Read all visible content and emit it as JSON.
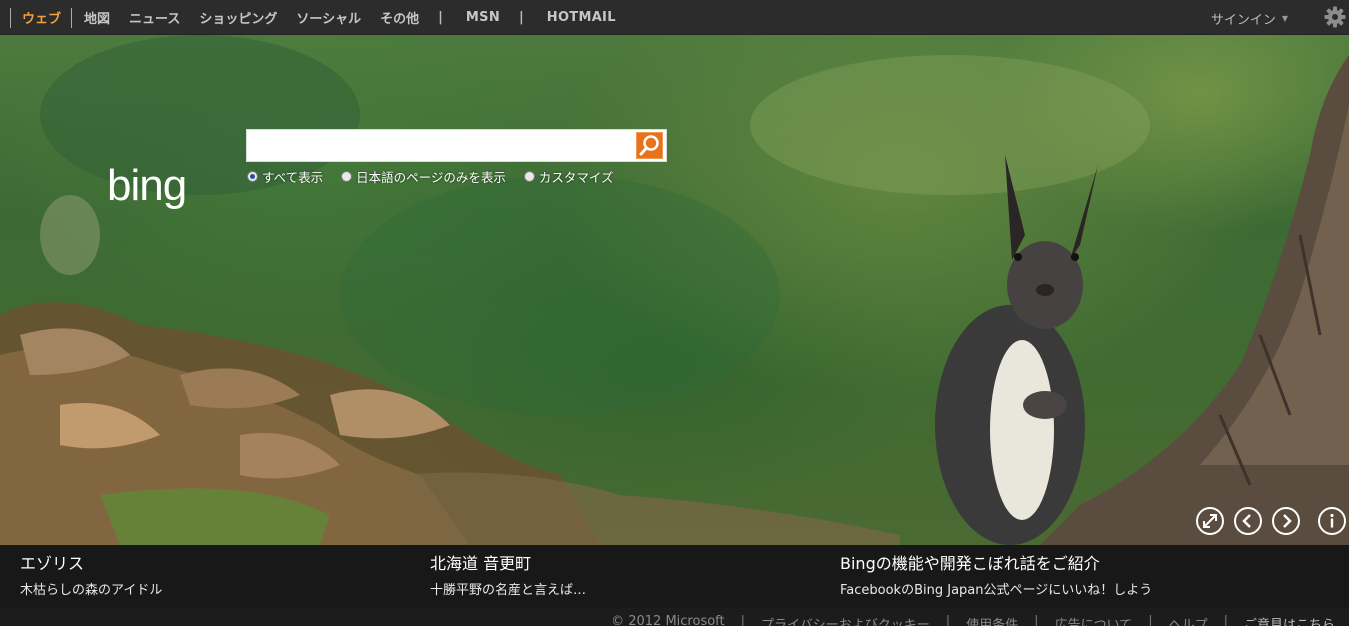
{
  "nav": {
    "items": [
      "ウェブ",
      "地図",
      "ニュース",
      "ショッピング",
      "ソーシャル",
      "その他"
    ],
    "separator": "|",
    "msn": "MSN",
    "hotmail": "HOTMAIL",
    "signin": "サインイン"
  },
  "search": {
    "value": "",
    "options": [
      "すべて表示",
      "日本語のページのみを表示",
      "カスタマイズ"
    ],
    "selected_option": "すべて表示"
  },
  "logo_text": "bing",
  "colors": {
    "accent": "#f2a13a",
    "search_button": "#e8711b"
  },
  "captions": [
    {
      "title": "エゾリス",
      "subtitle": "木枯らしの森のアイドル"
    },
    {
      "title": "北海道 音更町",
      "subtitle": "十勝平野の名産と言えば…"
    },
    {
      "title": "Bingの機能や開発こぼれ話をご紹介",
      "subtitle": "FacebookのBing Japan公式ページにいいね！しよう"
    }
  ],
  "footer": {
    "links": [
      "© 2012 Microsoft",
      "プライバシーおよびクッキー",
      "使用条件",
      "広告について",
      "ヘルプ",
      "ご意見はこちら"
    ],
    "separator": "|"
  },
  "icons": [
    "settings-gear-icon",
    "search-icon",
    "fullscreen-icon",
    "previous-icon",
    "next-icon",
    "info-icon"
  ]
}
